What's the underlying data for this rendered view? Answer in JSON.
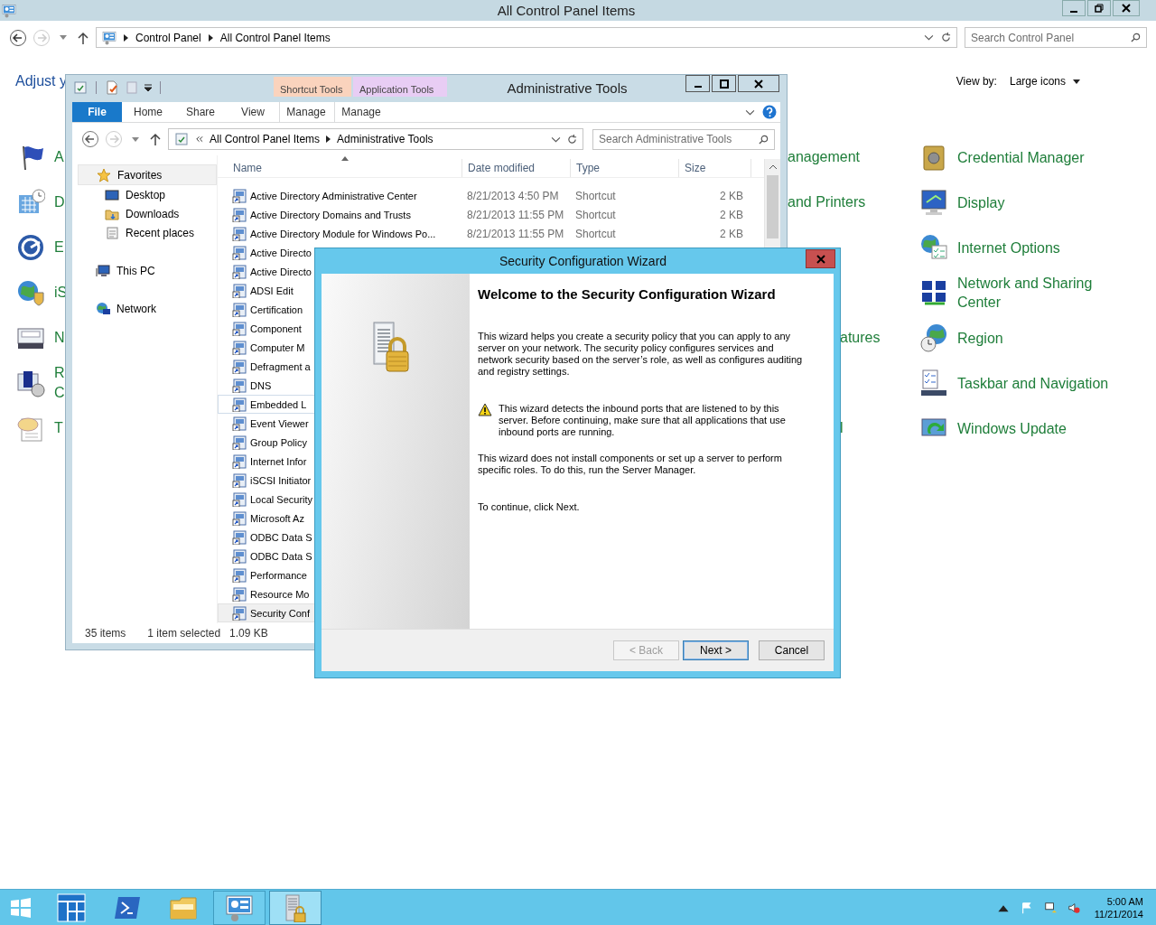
{
  "control_panel": {
    "title": "All Control Panel Items",
    "breadcrumb": [
      "Control Panel",
      "All Control Panel Items"
    ],
    "search": {
      "placeholder": "Search Control Panel"
    },
    "heading": "Adjust y",
    "view_by": {
      "label": "View by:",
      "value": "Large icons"
    },
    "left_items": [
      {
        "lines": [
          "A"
        ]
      },
      {
        "lines": [
          "D"
        ]
      },
      {
        "lines": [
          "E"
        ]
      },
      {
        "lines": [
          "iS"
        ]
      },
      {
        "lines": [
          "N"
        ]
      },
      {
        "lines": [
          "R",
          "C"
        ]
      },
      {
        "lines": [
          "T"
        ]
      }
    ],
    "middle_items": [
      "anagement",
      "and Printers",
      "atures",
      "l"
    ],
    "right_items": [
      "Credential Manager",
      "Display",
      "Internet Options",
      "Network and Sharing Center",
      "Region",
      "Taskbar and Navigation",
      "Windows Update"
    ]
  },
  "explorer": {
    "title": "Administrative Tools",
    "context_groups": [
      {
        "group": "Shortcut Tools",
        "tab": "Manage",
        "color": "#fad3bd"
      },
      {
        "group": "Application Tools",
        "tab": "Manage",
        "color": "#e8cdf4"
      }
    ],
    "ribbon_tabs": [
      {
        "label": "File",
        "kind": "file"
      },
      {
        "label": "Home",
        "kind": "tab"
      },
      {
        "label": "Share",
        "kind": "tab"
      },
      {
        "label": "View",
        "kind": "tab"
      }
    ],
    "path": [
      "All Control Panel Items",
      "Administrative Tools"
    ],
    "search": {
      "placeholder": "Search Administrative Tools"
    },
    "nav": [
      {
        "label": "Favorites",
        "selected": true,
        "children": [
          {
            "label": "Desktop",
            "selected": false
          },
          {
            "label": "Downloads",
            "selected": false
          },
          {
            "label": "Recent places",
            "selected": false
          }
        ]
      },
      {
        "label": "This PC",
        "selected": false
      },
      {
        "label": "Network",
        "selected": false
      }
    ],
    "columns": [
      "Name",
      "Date modified",
      "Type",
      "Size"
    ],
    "rows": [
      {
        "name": "Active Directory Administrative Center",
        "date": "8/21/2013 4:50 PM",
        "type": "Shortcut",
        "size": "2 KB",
        "selected": false,
        "hovered": false
      },
      {
        "name": "Active Directory Domains and Trusts",
        "date": "8/21/2013 11:55 PM",
        "type": "Shortcut",
        "size": "2 KB",
        "selected": false,
        "hovered": false
      },
      {
        "name": "Active Directory Module for Windows Po...",
        "date": "8/21/2013 11:55 PM",
        "type": "Shortcut",
        "size": "2 KB",
        "selected": false,
        "hovered": false
      },
      {
        "name": "Active Directo",
        "selected": false,
        "hovered": false
      },
      {
        "name": "Active Directo",
        "selected": false,
        "hovered": false
      },
      {
        "name": "ADSI Edit",
        "selected": false,
        "hovered": false
      },
      {
        "name": "Certification",
        "selected": false,
        "hovered": false
      },
      {
        "name": "Component",
        "selected": false,
        "hovered": false
      },
      {
        "name": "Computer M",
        "selected": false,
        "hovered": false
      },
      {
        "name": "Defragment a",
        "selected": false,
        "hovered": false
      },
      {
        "name": "DNS",
        "selected": false,
        "hovered": false
      },
      {
        "name": "Embedded L",
        "selected": false,
        "hovered": true
      },
      {
        "name": "Event Viewer",
        "selected": false,
        "hovered": false
      },
      {
        "name": "Group Policy",
        "selected": false,
        "hovered": false
      },
      {
        "name": "Internet Infor",
        "selected": false,
        "hovered": false
      },
      {
        "name": "iSCSI Initiator",
        "selected": false,
        "hovered": false
      },
      {
        "name": "Local Security",
        "selected": false,
        "hovered": false
      },
      {
        "name": "Microsoft Az",
        "selected": false,
        "hovered": false
      },
      {
        "name": "ODBC Data S",
        "selected": false,
        "hovered": false
      },
      {
        "name": "ODBC Data S",
        "selected": false,
        "hovered": false
      },
      {
        "name": "Performance",
        "selected": false,
        "hovered": false
      },
      {
        "name": "Resource Mo",
        "selected": false,
        "hovered": false
      },
      {
        "name": "Security Conf",
        "selected": true,
        "hovered": false
      }
    ],
    "status": {
      "count": "35 items",
      "selection": "1 item selected",
      "size": "1.09 KB"
    }
  },
  "wizard": {
    "title": "Security Configuration Wizard",
    "heading": "Welcome to the Security Configuration Wizard",
    "paragraphs": [
      {
        "kind": "text",
        "text": "This wizard helps you create a security policy that you can apply to any server on your network. The security policy configures services and network security based on the server’s role, as well as configures auditing and registry settings."
      },
      {
        "kind": "warning",
        "text": "This wizard detects the inbound ports that are listened to by this server. Before continuing, make sure that all applications that use inbound ports are running."
      },
      {
        "kind": "text",
        "text": "This wizard does not install components or set up a server to perform specific roles. To do this, run the Server Manager."
      },
      {
        "kind": "text",
        "text": "To continue, click Next."
      }
    ],
    "buttons": [
      {
        "label": "< Back",
        "disabled": true,
        "default": false
      },
      {
        "label": "Next >",
        "disabled": false,
        "default": true
      },
      {
        "label": "Cancel",
        "disabled": false,
        "default": false
      }
    ]
  },
  "taskbar": {
    "apps": [
      {
        "running": false,
        "selected": false
      },
      {
        "running": false,
        "selected": false
      },
      {
        "running": false,
        "selected": false
      },
      {
        "running": true,
        "selected": false
      },
      {
        "running": true,
        "selected": true
      }
    ],
    "clock": {
      "time": "5:00 AM",
      "date": "11/21/2014"
    }
  }
}
